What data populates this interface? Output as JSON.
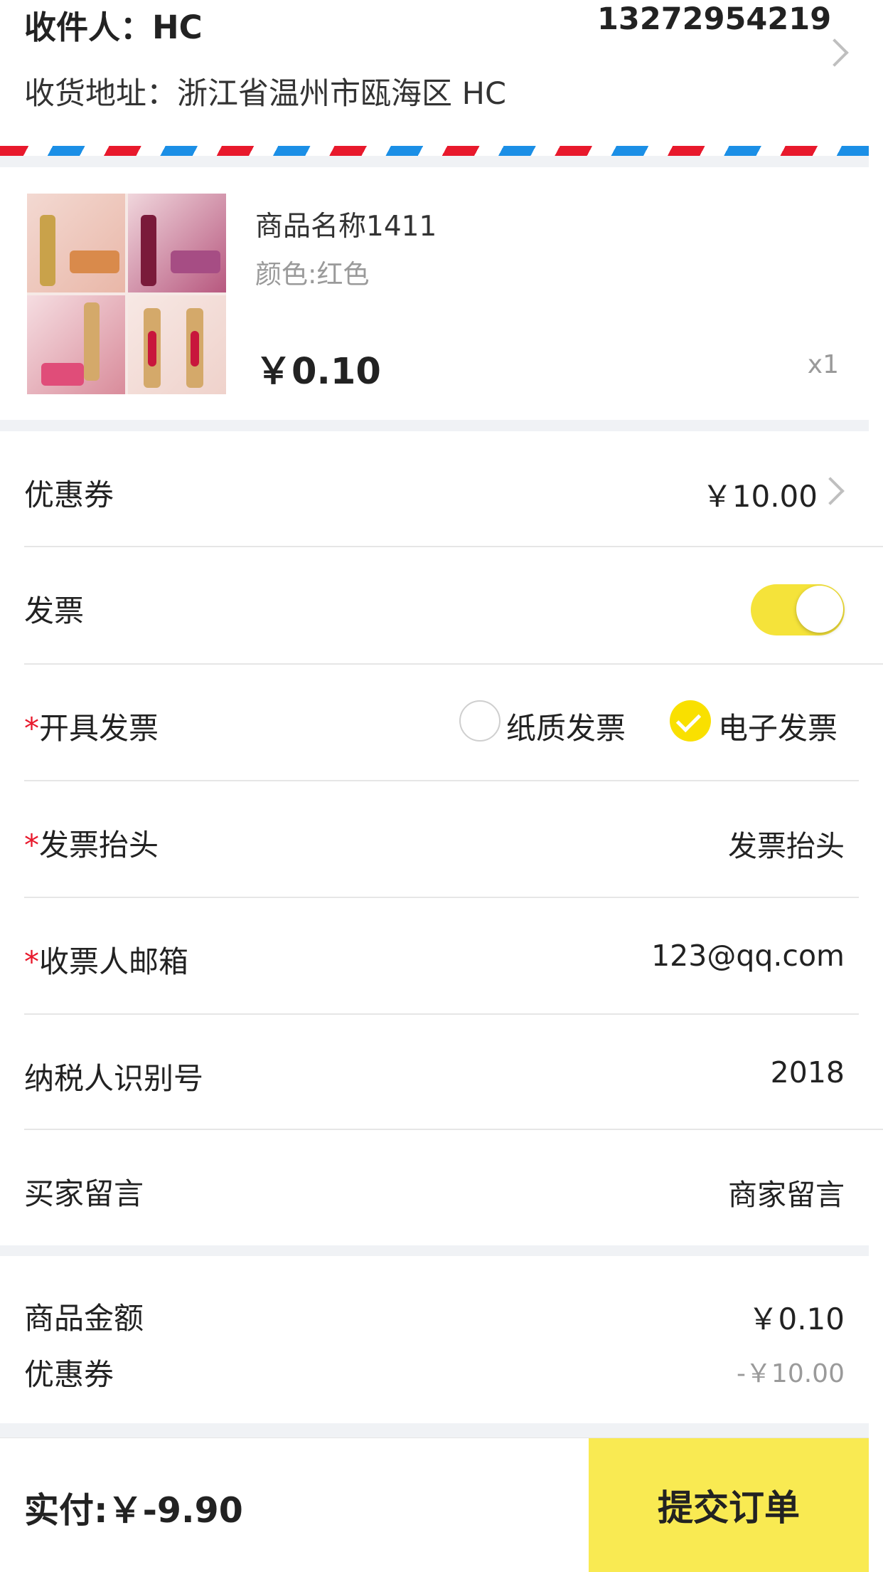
{
  "address": {
    "recipient": "收件人：HC",
    "phone": "13272954219",
    "address": "收货地址：浙江省温州市瓯海区 HC"
  },
  "product": {
    "name": "商品名称1411",
    "color": "颜色:红色",
    "price": "￥0.10",
    "quantity": "x1"
  },
  "coupon_row": {
    "label": "优惠券",
    "value": "￥10.00"
  },
  "invoice_row": {
    "label": "发票",
    "enabled": true
  },
  "invoice_type_row": {
    "required_mark": "*",
    "label": "开具发票",
    "options": [
      {
        "label": "纸质发票",
        "selected": false
      },
      {
        "label": "电子发票",
        "selected": true
      }
    ]
  },
  "invoice_title_row": {
    "required_mark": "*",
    "label": "发票抬头",
    "value": "发票抬头"
  },
  "email_row": {
    "required_mark": "*",
    "label": "收票人邮箱",
    "value": "123@qq.com"
  },
  "taxpayer_row": {
    "label": "纳税人识别号",
    "value": "2018"
  },
  "message_row": {
    "label": "买家留言",
    "value": "商家留言"
  },
  "summary": {
    "goods_label": "商品金额",
    "goods_value": "￥0.10",
    "coupon_label": "优惠券",
    "coupon_value": "-￥10.00"
  },
  "footer": {
    "pay_label": "实付:￥-9.90",
    "submit_label": "提交订单"
  },
  "colors": {
    "accent_yellow": "#f9ea52",
    "stripe_red": "#e8192c",
    "stripe_blue": "#1b8fe6",
    "muted_text": "#9a9a9a"
  }
}
